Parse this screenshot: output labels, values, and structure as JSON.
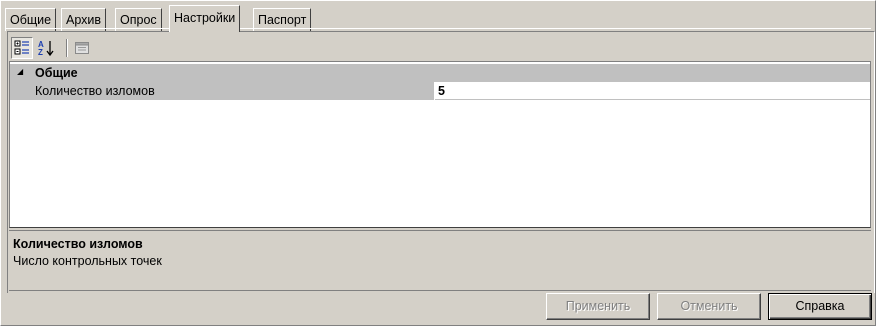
{
  "tabs": [
    {
      "label": "Общие",
      "active": false
    },
    {
      "label": "Архив",
      "active": false
    },
    {
      "label": "Опрос",
      "active": false
    },
    {
      "label": "Настройки",
      "active": true
    },
    {
      "label": "Паспорт",
      "active": false
    }
  ],
  "toolbar": {
    "categorized_icon": "categorized-view-icon",
    "alphabetical_icon": "sort-alphabetical-icon",
    "property_pages_icon": "property-pages-icon"
  },
  "grid": {
    "category": {
      "label": "Общие",
      "expanded": true
    },
    "properties": [
      {
        "name": "Количество изломов",
        "value": "5"
      }
    ]
  },
  "description": {
    "title": "Количество изломов",
    "text": "Число контрольных точек"
  },
  "buttons": {
    "apply": "Применить",
    "cancel": "Отменить",
    "help": "Справка"
  },
  "colors": {
    "face": "#d4d0c8",
    "category_band": "#c0c0c0",
    "disabled_text": "#808080"
  }
}
